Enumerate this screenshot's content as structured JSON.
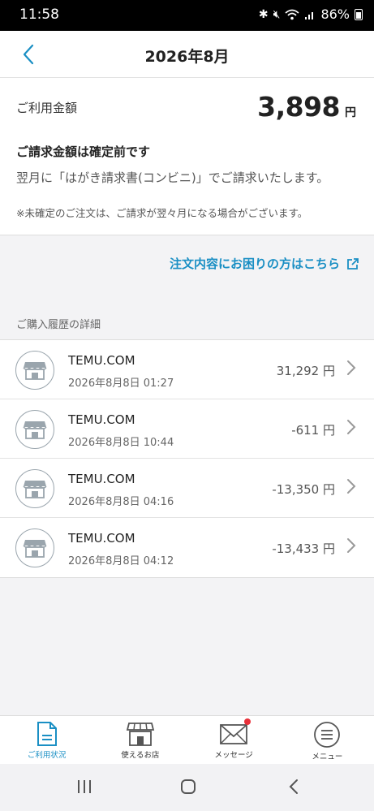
{
  "status_bar": {
    "time": "11:58",
    "battery": "86%"
  },
  "header": {
    "title": "2026年8月"
  },
  "summary": {
    "usage_label": "ご利用金額",
    "usage_amount": "3,898",
    "currency": "円",
    "notice_title": "ご請求金額は確定前です",
    "notice_body": "翌月に「はがき請求書(コンビニ)」でご請求いたします。",
    "notice_note": "※未確定のご注文は、ご請求が翌々月になる場合がございます。"
  },
  "help_link": {
    "label": "注文内容にお困りの方はこちら"
  },
  "history": {
    "section_label": "ご購入履歴の詳細",
    "items": [
      {
        "merchant": "TEMU.COM",
        "datetime": "2026年8月8日 01:27",
        "amount": "31,292 円"
      },
      {
        "merchant": "TEMU.COM",
        "datetime": "2026年8月8日 10:44",
        "amount": "-611 円"
      },
      {
        "merchant": "TEMU.COM",
        "datetime": "2026年8月8日 04:16",
        "amount": "-13,350 円"
      },
      {
        "merchant": "TEMU.COM",
        "datetime": "2026年8月8日 04:12",
        "amount": "-13,433 円"
      }
    ]
  },
  "bottom_nav": {
    "items": [
      {
        "label": "ご利用状況",
        "icon": "document-icon"
      },
      {
        "label": "使えるお店",
        "icon": "store-icon"
      },
      {
        "label": "メッセージ",
        "icon": "mail-icon"
      },
      {
        "label": "メニュー",
        "icon": "menu-icon"
      }
    ],
    "active_index": 0
  },
  "colors": {
    "accent": "#1a8fc4",
    "badge": "#e8303a",
    "icon_gray": "#9aa5ad"
  }
}
